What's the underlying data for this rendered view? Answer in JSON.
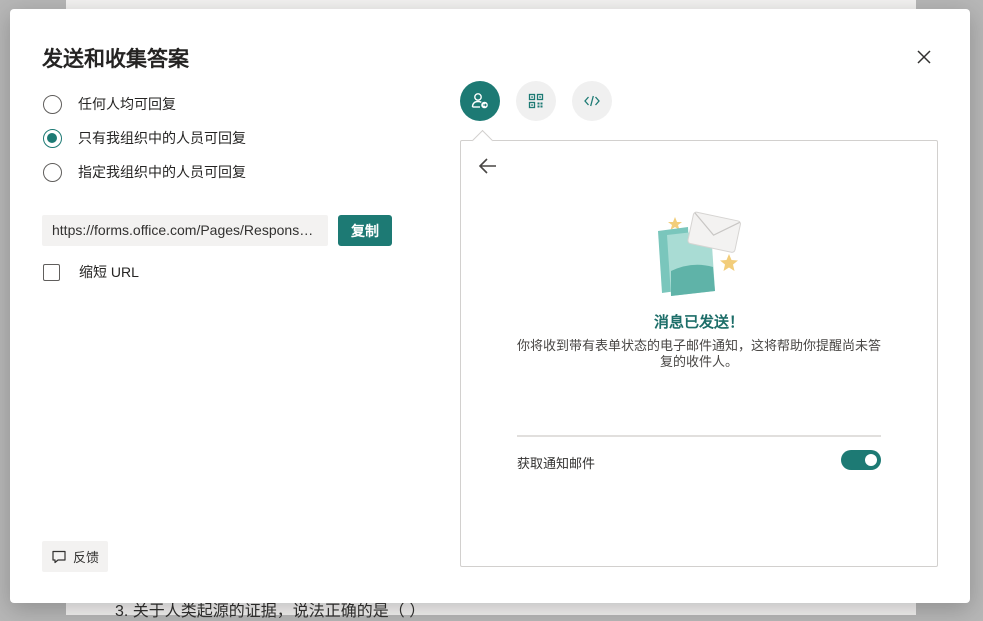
{
  "background": {
    "question_text": "3. 关于人类起源的证据，说法正确的是（    ）"
  },
  "dialog": {
    "title": "发送和收集答案",
    "close_icon": "close-icon"
  },
  "permissions": {
    "options": [
      {
        "label": "任何人均可回复",
        "selected": false
      },
      {
        "label": "只有我组织中的人员可回复",
        "selected": true
      },
      {
        "label": "指定我组织中的人员可回复",
        "selected": false
      }
    ]
  },
  "link": {
    "url": "https://forms.office.com/Pages/ResponsePage.aspx",
    "copy_label": "复制"
  },
  "shorten": {
    "label": "缩短 URL",
    "checked": false
  },
  "feedback": {
    "label": "反馈",
    "icon": "comment-icon"
  },
  "share_tabs": [
    {
      "icon": "person-send-icon",
      "active": true
    },
    {
      "icon": "qr-code-icon",
      "active": false
    },
    {
      "icon": "embed-code-icon",
      "active": false
    }
  ],
  "panel": {
    "back_icon": "arrow-left-icon",
    "title": "消息已发送！",
    "description": "你将收到带有表单状态的电子邮件通知，这将帮助你提醒尚未答复的收件人。",
    "toggle_label": "获取通知邮件",
    "toggle_on": true
  },
  "colors": {
    "accent": "#1d7a74",
    "accent_text": "#1d6e69"
  }
}
